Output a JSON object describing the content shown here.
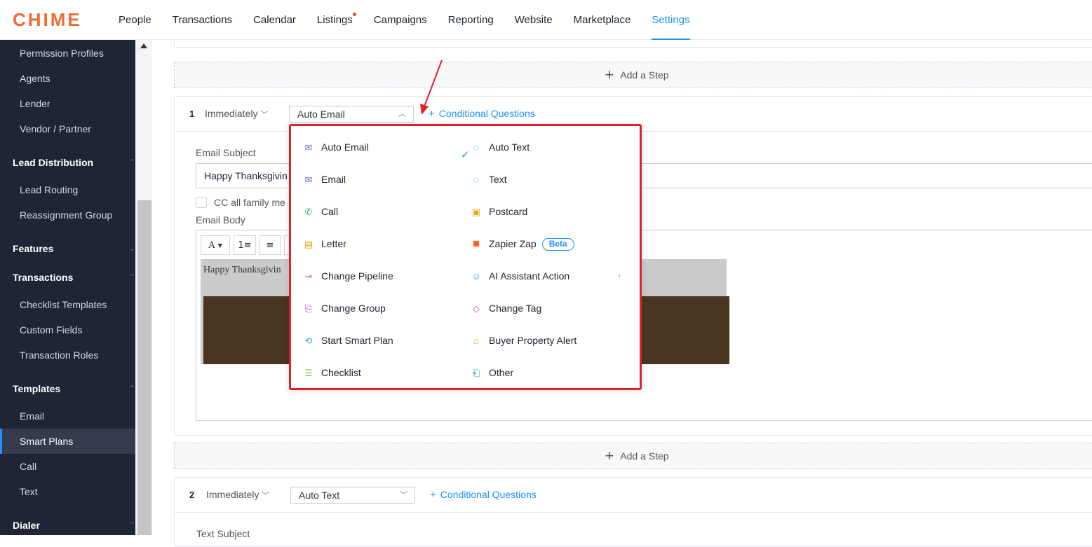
{
  "brand": {
    "logo": "CHIME",
    "accent": "#f16b35"
  },
  "topnav": {
    "items": [
      "People",
      "Transactions",
      "Calendar",
      "Listings",
      "Campaigns",
      "Reporting",
      "Website",
      "Marketplace",
      "Settings"
    ],
    "active": "Settings",
    "active_color": "#1e90ff"
  },
  "sidebar": {
    "items": [
      {
        "label": "Permission Profiles",
        "type": "item"
      },
      {
        "label": "Agents",
        "type": "item"
      },
      {
        "label": "Lender",
        "type": "item"
      },
      {
        "label": "Vendor / Partner",
        "type": "item"
      },
      {
        "label": "Lead Distribution",
        "type": "group"
      },
      {
        "label": "Lead Routing",
        "type": "item"
      },
      {
        "label": "Reassignment Group",
        "type": "item"
      },
      {
        "label": "Features",
        "type": "group"
      },
      {
        "label": "Transactions",
        "type": "group"
      },
      {
        "label": "Checklist Templates",
        "type": "item"
      },
      {
        "label": "Custom Fields",
        "type": "item"
      },
      {
        "label": "Transaction Roles",
        "type": "item"
      },
      {
        "label": "Templates",
        "type": "group"
      },
      {
        "label": "Email",
        "type": "item"
      },
      {
        "label": "Smart Plans",
        "type": "item",
        "active": true
      },
      {
        "label": "Call",
        "type": "item"
      },
      {
        "label": "Text",
        "type": "item"
      },
      {
        "label": "Dialer",
        "type": "group"
      }
    ]
  },
  "add_step": {
    "label": "Add a Step"
  },
  "step1": {
    "number": "1",
    "timing": "Immediately",
    "action": "Auto Email",
    "conditional": "Conditional Questions",
    "subject_label": "Email Subject",
    "subject_value": "Happy Thanksgivin",
    "cc_label": "CC all family me",
    "body_label": "Email Body",
    "body_text": "Happy Thanksgivin",
    "toolbar": {
      "font": "A",
      "ordered": "1≡",
      "bullet": "≡"
    }
  },
  "dropdown": {
    "items_left": [
      {
        "label": "Auto Email",
        "icon": "auto-email-icon",
        "glyph": "✉",
        "color": "#5b7bd5"
      },
      {
        "label": "Email",
        "icon": "email-icon",
        "glyph": "✉",
        "color": "#5b7bd5"
      },
      {
        "label": "Call",
        "icon": "phone-icon",
        "glyph": "✆",
        "color": "#3bb273"
      },
      {
        "label": "Letter",
        "icon": "letter-icon",
        "glyph": "▤",
        "color": "#e6a817"
      },
      {
        "label": "Change Pipeline",
        "icon": "pipeline-icon",
        "glyph": "⊸",
        "color": "#b44bd8"
      },
      {
        "label": "Change Group",
        "icon": "group-icon",
        "glyph": "⎘",
        "color": "#b44bd8"
      },
      {
        "label": "Start Smart Plan",
        "icon": "smart-plan-icon",
        "glyph": "⟲",
        "color": "#2aa5c8"
      },
      {
        "label": "Checklist",
        "icon": "checklist-icon",
        "glyph": "☰",
        "color": "#8bc34a"
      }
    ],
    "items_right": [
      {
        "label": "Auto Text",
        "icon": "auto-text-icon",
        "glyph": "◌",
        "color": "#2aa5c8"
      },
      {
        "label": "Text",
        "icon": "text-icon",
        "glyph": "◌",
        "color": "#2aa5c8"
      },
      {
        "label": "Postcard",
        "icon": "postcard-icon",
        "glyph": "▣",
        "color": "#e6a817"
      },
      {
        "label": "Zapier Zap",
        "icon": "zapier-icon",
        "glyph": "■",
        "color": "#f36b21",
        "badge": "Beta"
      },
      {
        "label": "AI Assistant Action",
        "icon": "ai-assistant-icon",
        "glyph": "☺",
        "color": "#2a8fd8",
        "submenu": true
      },
      {
        "label": "Change Tag",
        "icon": "tag-icon",
        "glyph": "◇",
        "color": "#b44bd8"
      },
      {
        "label": "Buyer Property Alert",
        "icon": "house-icon",
        "glyph": "⌂",
        "color": "#e6a817"
      },
      {
        "label": "Other",
        "icon": "other-icon",
        "glyph": "⎗",
        "color": "#2aa5c8"
      }
    ],
    "selected": "Auto Email",
    "highlight_color": "#e0202a"
  },
  "step2": {
    "number": "2",
    "timing": "Immediately",
    "action": "Auto Text",
    "conditional": "Conditional Questions",
    "subject_label": "Text Subject"
  }
}
